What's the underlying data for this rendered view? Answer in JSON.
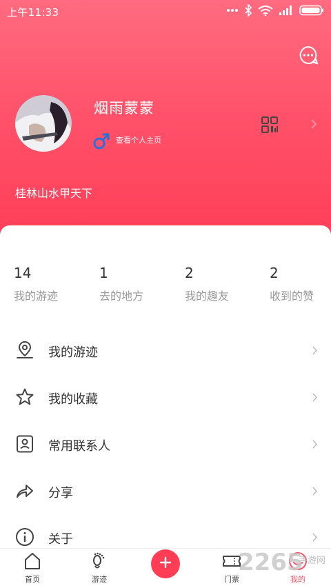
{
  "status_bar": {
    "time": "上午11:33",
    "icons": [
      "more-dots-icon",
      "bluetooth-icon",
      "wifi-icon",
      "signal-icon",
      "battery-icon"
    ]
  },
  "profile": {
    "username": "烟雨蒙蒙",
    "view_profile": "查看个人主页",
    "bio": "桂林山水甲天下",
    "gender_icon": "male-icon"
  },
  "stats": [
    {
      "value": "14",
      "label": "我的游迹"
    },
    {
      "value": "1",
      "label": "去的地方"
    },
    {
      "value": "2",
      "label": "我的趣友"
    },
    {
      "value": "2",
      "label": "收到的赞"
    }
  ],
  "menu": [
    {
      "label": "我的游迹",
      "icon": "location-pin-icon"
    },
    {
      "label": "我的收藏",
      "icon": "star-icon"
    },
    {
      "label": "常用联系人",
      "icon": "contact-card-icon"
    },
    {
      "label": "分享",
      "icon": "share-arrow-icon"
    },
    {
      "label": "关于",
      "icon": "info-icon"
    }
  ],
  "tabbar": {
    "tabs": [
      {
        "label": "首页",
        "icon": "home-icon"
      },
      {
        "label": "游迹",
        "icon": "footprint-icon"
      },
      {
        "label": "门票",
        "icon": "ticket-icon"
      },
      {
        "label": "我的",
        "icon": "profile-icon",
        "active": true
      }
    ],
    "fab_icon": "plus-icon"
  },
  "watermark": {
    "main": "2265",
    "sub": "手游网"
  },
  "colors": {
    "accent": "#ff4d65",
    "header_top": "#ff6b80",
    "header_bottom": "#ff3d58",
    "fab": "#ff3d55"
  }
}
